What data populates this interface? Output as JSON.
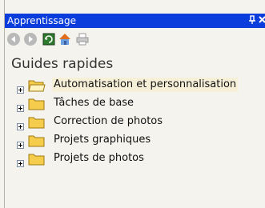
{
  "panel": {
    "title": "Apprentissage",
    "pin_glyph": "ᵽ",
    "close_glyph": "×"
  },
  "toolbar": {
    "buttons": [
      {
        "name": "back-icon"
      },
      {
        "name": "forward-icon"
      },
      {
        "name": "refresh-icon"
      },
      {
        "name": "home-icon"
      },
      {
        "name": "print-icon"
      }
    ]
  },
  "heading": "Guides rapides",
  "tree": {
    "items": [
      {
        "label": "Automatisation et personnalisation",
        "selected": true
      },
      {
        "label": "Tâches de base",
        "selected": false
      },
      {
        "label": "Correction de photos",
        "selected": false
      },
      {
        "label": "Projets graphiques",
        "selected": false
      },
      {
        "label": "Projets de photos",
        "selected": false
      }
    ]
  },
  "colors": {
    "titlebar": "#0a3ddc",
    "background": "#f4f3ee",
    "selected_highlight": "#f7f0d8",
    "folder": "#f5cc4c"
  }
}
